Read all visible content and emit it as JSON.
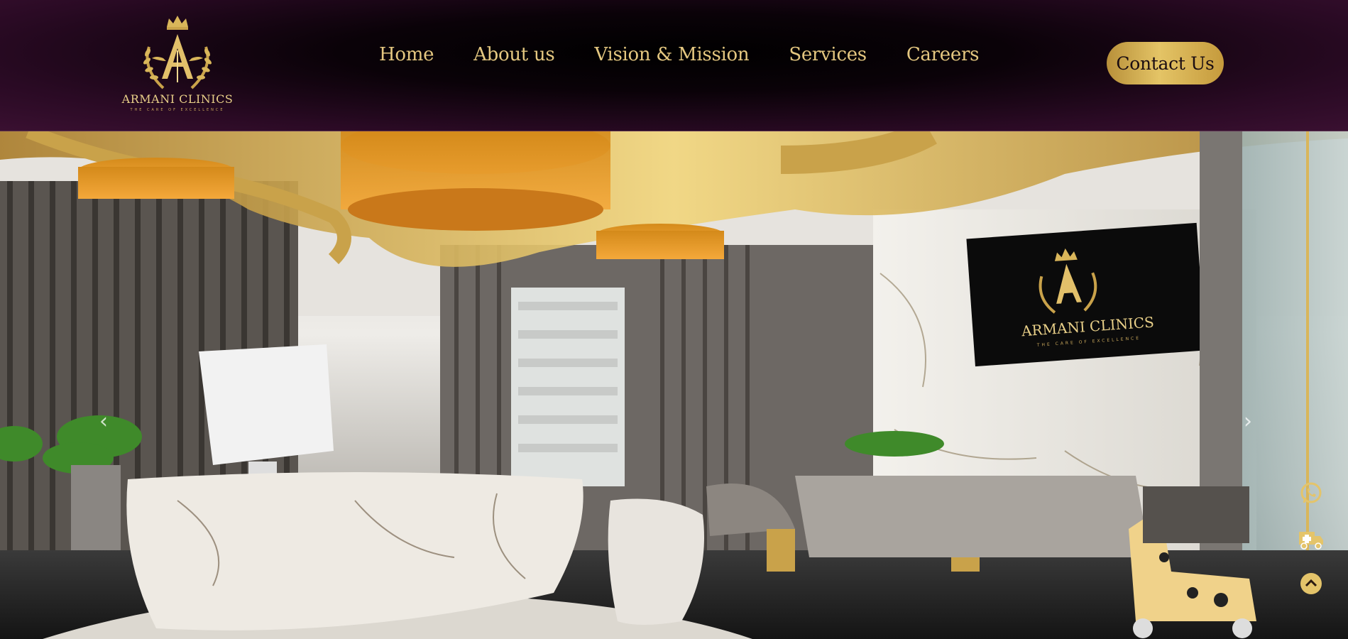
{
  "brand": {
    "name": "ARMANI CLINICS",
    "tagline": "THE CARE OF EXCELLENCE"
  },
  "nav": [
    {
      "label": "Home"
    },
    {
      "label": "About us"
    },
    {
      "label": "Vision & Mission"
    },
    {
      "label": "Services"
    },
    {
      "label": "Careers"
    }
  ],
  "header": {
    "contact_label": "Contact Us"
  },
  "hero": {
    "sign_brand": "ARMANI CLINICS",
    "sign_tagline": "THE CARE OF EXCELLENCE",
    "prev_arrow": "‹",
    "next_arrow": "›"
  },
  "floating": [
    {
      "icon": "whatsapp-icon"
    },
    {
      "icon": "ambulance-icon"
    },
    {
      "icon": "scroll-top-icon"
    }
  ],
  "colors": {
    "gold": "#e4c780",
    "header_bg": "#2a0a24",
    "button_gold": "#d4b050"
  }
}
